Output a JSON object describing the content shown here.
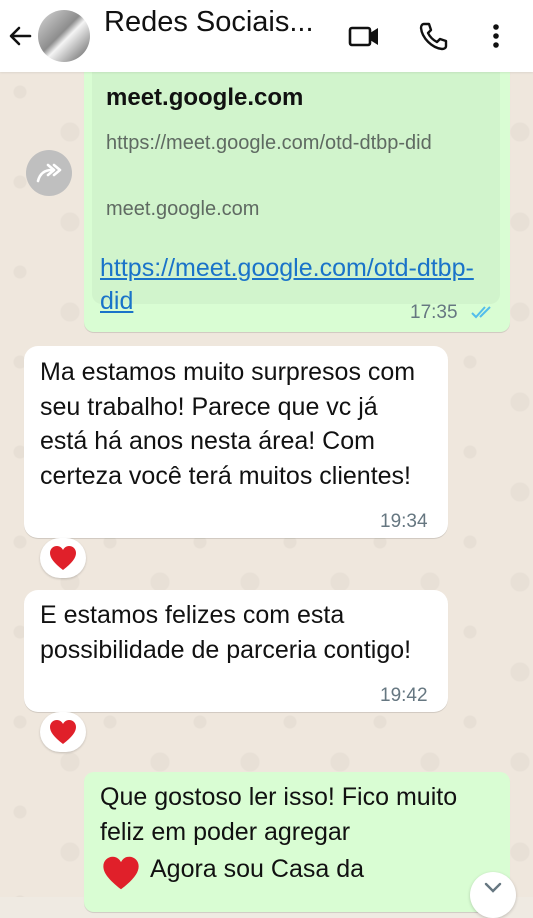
{
  "header": {
    "title": "Redes Sociais...",
    "icons": [
      "back-arrow-icon",
      "video-call-icon",
      "voice-call-icon",
      "more-options-icon"
    ]
  },
  "messages": {
    "link_preview": {
      "title": "meet.google.com",
      "url": "https://meet.google.com/otd-dtbp-did",
      "domain": "meet.google.com",
      "link_text": "https://meet.google.com/otd-dtbp-did",
      "time": "17:35",
      "read_status": "read"
    },
    "incoming_1": {
      "text": "Ma estamos muito surpresos com seu trabalho! Parece que vc já está há anos nesta área! Com certeza você terá muitos clientes!",
      "time": "19:34",
      "reaction": "❤️"
    },
    "incoming_2": {
      "text": "E estamos felizes com esta possibilidade de parceria contigo!",
      "time": "19:42",
      "reaction": "❤️"
    },
    "outgoing_2": {
      "text_part1": "Que gostoso ler isso! Fico muito feliz em poder agregar",
      "emoji": "❤️",
      "text_part2": "Agora sou Casa da"
    }
  },
  "colors": {
    "header_bg": "#ffffff",
    "outgoing_bubble": "#d9fdd3",
    "incoming_bubble": "#ffffff",
    "link": "#1a73c9",
    "read_ticks": "#53bdeb",
    "heart": "#e0202a"
  }
}
